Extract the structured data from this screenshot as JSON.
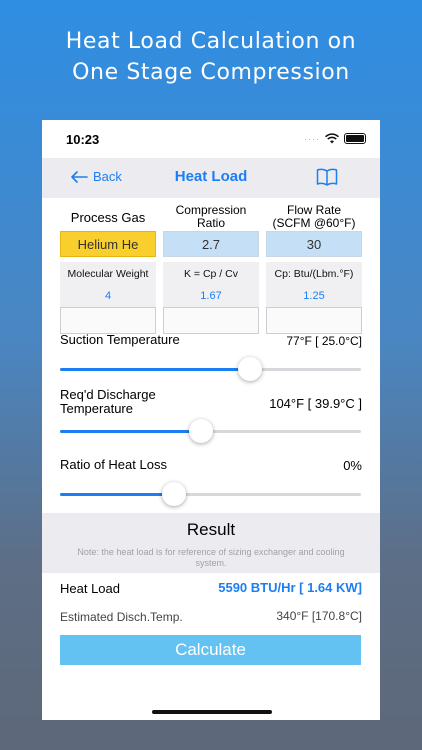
{
  "headline": {
    "line1": "Heat Load Calculation on",
    "line2": "One Stage Compression"
  },
  "status_bar": {
    "time": "10:23",
    "signal": "····"
  },
  "nav": {
    "back_label": "Back",
    "title": "Heat Load",
    "back_icon": "arrow-left-icon",
    "book_icon": "book-icon"
  },
  "inputs": {
    "process_gas": {
      "label": "Process Gas",
      "value": "Helium He"
    },
    "compression_ratio": {
      "label_line1": "Compression",
      "label_line2": "Ratio",
      "value": "2.7"
    },
    "flow_rate": {
      "label_line1": "Flow Rate",
      "label_line2": "(SCFM @60°F)",
      "value": "30"
    }
  },
  "properties": {
    "molecular_weight": {
      "label": "Molecular Weight",
      "value": "4"
    },
    "k": {
      "label": "K = Cp / Cv",
      "value": "1.67"
    },
    "cp": {
      "label": "Cp: Btu/(Lbm.°F)",
      "value": "1.25"
    }
  },
  "sliders": {
    "suction_temperature": {
      "label": "Suction Temperature",
      "value": "77°F [ 25.0°C]",
      "fraction": 0.63
    },
    "discharge_temperature": {
      "label_line1": "Req'd Discharge",
      "label_line2": "Temperature",
      "value": "104°F [ 39.9°C ]",
      "fraction": 0.47
    },
    "heat_loss": {
      "label": "Ratio of Heat Loss",
      "value": "0%",
      "fraction": 0.38
    }
  },
  "result": {
    "title": "Result",
    "note": "Note: the heat load is for reference of sizing exchanger and cooling system.",
    "heat_load_label": "Heat Load",
    "heat_load_value": "5590 BTU/Hr [ 1.64 KW]",
    "disch_temp_label": "Estimated Disch.Temp.",
    "disch_temp_value": "340°F [170.8°C]"
  },
  "calculate_label": "Calculate",
  "colors": {
    "accent": "#1c7ef3",
    "gas_highlight": "#f8cf2c",
    "input_blue": "#c5e0f6",
    "button": "#64c2f2"
  }
}
